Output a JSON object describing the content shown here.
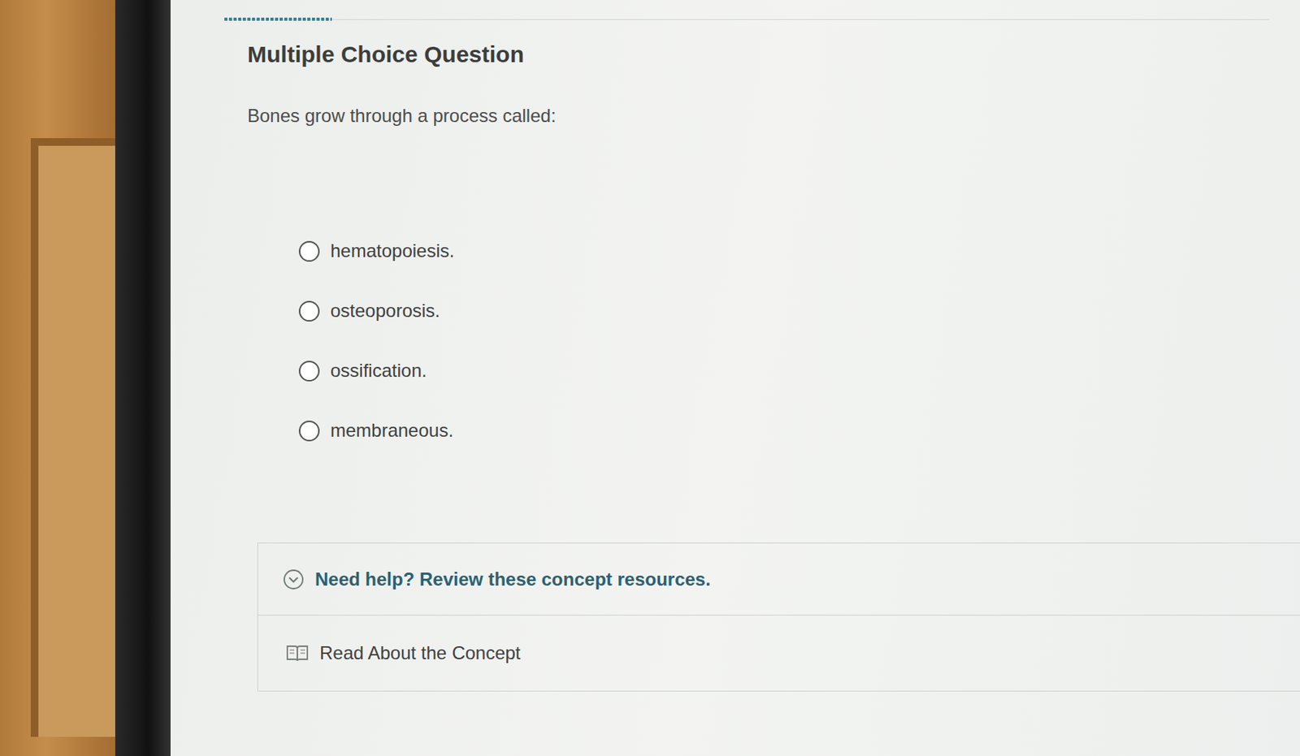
{
  "question": {
    "heading": "Multiple Choice Question",
    "text": "Bones grow through a process called:"
  },
  "options": [
    {
      "label": "hematopoiesis.",
      "selected": false
    },
    {
      "label": "osteoporosis.",
      "selected": false
    },
    {
      "label": "ossification.",
      "selected": false
    },
    {
      "label": "membraneous.",
      "selected": false
    }
  ],
  "help": {
    "label": "Need help? Review these concept resources.",
    "expanded": true,
    "resources": [
      "Read About the Concept"
    ]
  }
}
